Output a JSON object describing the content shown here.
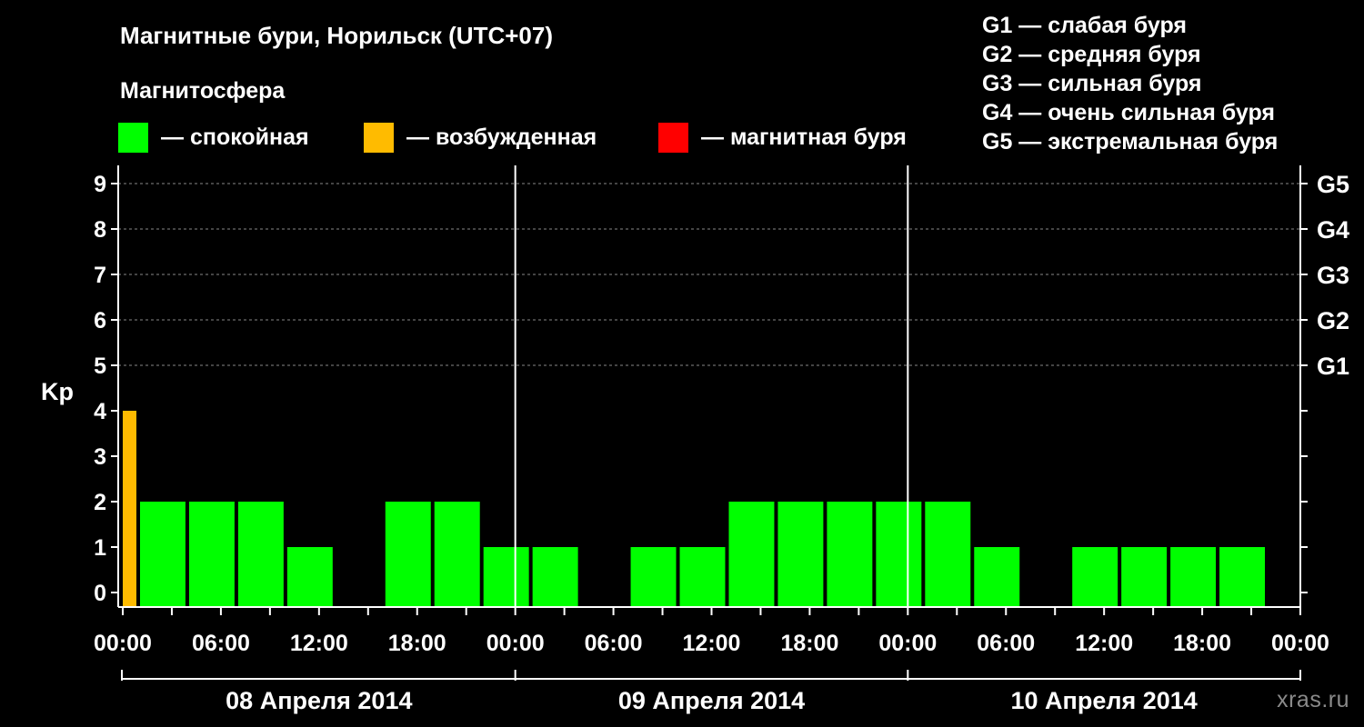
{
  "title": "Магнитные бури, Норильск (UTC+07)",
  "subtitle": "Магнитосфера",
  "legend": [
    {
      "label": "— спокойная",
      "color": "#00ff00"
    },
    {
      "label": "— возбужденная",
      "color": "#ffbb00"
    },
    {
      "label": "— магнитная буря",
      "color": "#ff0000"
    }
  ],
  "g_scale": [
    "G1 — слабая буря",
    "G2 — средняя буря",
    "G3 — сильная буря",
    "G4 — очень сильная буря",
    "G5 — экстремальная буря"
  ],
  "watermark": "xras.ru",
  "chart_data": {
    "type": "bar",
    "ylabel": "Kp",
    "ylim": [
      0,
      9
    ],
    "yticks": [
      "0",
      "1",
      "2",
      "3",
      "4",
      "5",
      "6",
      "7",
      "8",
      "9"
    ],
    "right_ticks": [
      {
        "value": 5,
        "label": "G1"
      },
      {
        "value": 6,
        "label": "G2"
      },
      {
        "value": 7,
        "label": "G3"
      },
      {
        "value": 8,
        "label": "G4"
      },
      {
        "value": 9,
        "label": "G5"
      }
    ],
    "x_ticks": [
      "00:00",
      "06:00",
      "12:00",
      "18:00",
      "00:00",
      "06:00",
      "12:00",
      "18:00",
      "00:00",
      "06:00",
      "12:00",
      "18:00",
      "00:00"
    ],
    "days": [
      "08 Апреля 2014",
      "09 Апреля 2014",
      "10 Апреля 2014"
    ],
    "grid": true,
    "bars": [
      {
        "start_hour": 0,
        "end_hour": 1,
        "value": 4,
        "color": "#ffbb00"
      },
      {
        "start_hour": 1,
        "end_hour": 4,
        "value": 2,
        "color": "#00ff00"
      },
      {
        "start_hour": 4,
        "end_hour": 7,
        "value": 2,
        "color": "#00ff00"
      },
      {
        "start_hour": 7,
        "end_hour": 10,
        "value": 2,
        "color": "#00ff00"
      },
      {
        "start_hour": 10,
        "end_hour": 13,
        "value": 1,
        "color": "#00ff00"
      },
      {
        "start_hour": 13,
        "end_hour": 16,
        "value": 0,
        "color": "#00ff00"
      },
      {
        "start_hour": 16,
        "end_hour": 19,
        "value": 2,
        "color": "#00ff00"
      },
      {
        "start_hour": 19,
        "end_hour": 22,
        "value": 2,
        "color": "#00ff00"
      },
      {
        "start_hour": 22,
        "end_hour": 25,
        "value": 1,
        "color": "#00ff00"
      },
      {
        "start_hour": 25,
        "end_hour": 28,
        "value": 1,
        "color": "#00ff00"
      },
      {
        "start_hour": 28,
        "end_hour": 31,
        "value": 0,
        "color": "#00ff00"
      },
      {
        "start_hour": 31,
        "end_hour": 34,
        "value": 1,
        "color": "#00ff00"
      },
      {
        "start_hour": 34,
        "end_hour": 37,
        "value": 1,
        "color": "#00ff00"
      },
      {
        "start_hour": 37,
        "end_hour": 40,
        "value": 2,
        "color": "#00ff00"
      },
      {
        "start_hour": 40,
        "end_hour": 43,
        "value": 2,
        "color": "#00ff00"
      },
      {
        "start_hour": 43,
        "end_hour": 46,
        "value": 2,
        "color": "#00ff00"
      },
      {
        "start_hour": 46,
        "end_hour": 49,
        "value": 2,
        "color": "#00ff00"
      },
      {
        "start_hour": 49,
        "end_hour": 52,
        "value": 2,
        "color": "#00ff00"
      },
      {
        "start_hour": 52,
        "end_hour": 55,
        "value": 1,
        "color": "#00ff00"
      },
      {
        "start_hour": 55,
        "end_hour": 58,
        "value": 0,
        "color": "#00ff00"
      },
      {
        "start_hour": 58,
        "end_hour": 61,
        "value": 1,
        "color": "#00ff00"
      },
      {
        "start_hour": 61,
        "end_hour": 64,
        "value": 1,
        "color": "#00ff00"
      },
      {
        "start_hour": 64,
        "end_hour": 67,
        "value": 1,
        "color": "#00ff00"
      },
      {
        "start_hour": 67,
        "end_hour": 70,
        "value": 1,
        "color": "#00ff00"
      }
    ]
  }
}
